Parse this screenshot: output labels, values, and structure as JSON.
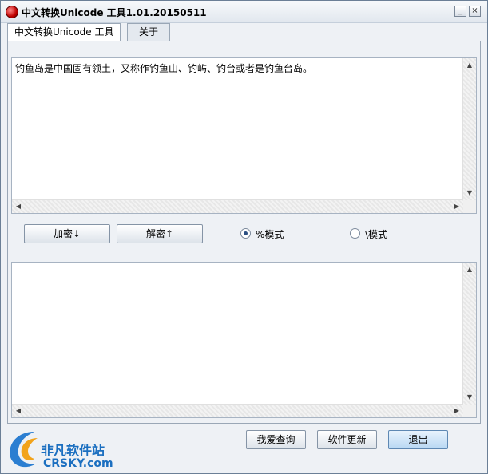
{
  "window": {
    "title": "中文转换Unicode 工具1.01.20150511",
    "minimize_glyph": "_",
    "close_glyph": "×"
  },
  "tabs": [
    {
      "label": "中文转换Unicode 工具",
      "active": true
    },
    {
      "label": "关于",
      "active": false
    }
  ],
  "input_box": {
    "value": "钓鱼岛是中国固有领土，又称作钓鱼山、钓屿、钓台或者是钓鱼台岛。"
  },
  "output_box": {
    "value": ""
  },
  "actions": {
    "encrypt_label": "加密↓",
    "decrypt_label": "解密↑"
  },
  "modes": {
    "percent_label": "%模式",
    "backslash_label": "\\模式",
    "selected": "percent"
  },
  "footer": {
    "query_label": "我爱查询",
    "update_label": "软件更新",
    "exit_label": "退出"
  },
  "watermark": {
    "name": "非凡软件站",
    "domain": "CRSKY.com"
  },
  "scroll_glyphs": {
    "up": "▲",
    "down": "▼",
    "left": "◀",
    "right": "▶"
  }
}
